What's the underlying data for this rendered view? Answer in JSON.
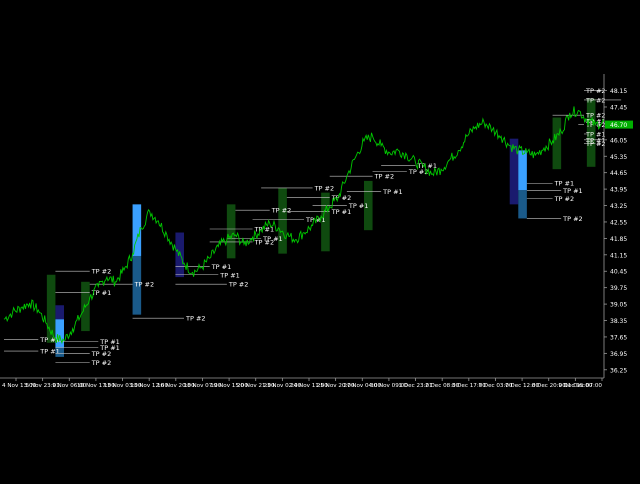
{
  "window": {
    "symbol_label": ""
  },
  "colors": {
    "background": "#000000",
    "price_line": "#00c800",
    "axis": "#9a9a9a",
    "axis_text": "#ffffff",
    "tp_line": "#c8c8c8",
    "tp_text": "#ffffff",
    "bull_zone": "#0f4a0f",
    "bull_zone_bright": "#1f8f1f",
    "bear_zone_dark": "#1a1a6e",
    "bear_zone_bright": "#3aa0ff",
    "bear_zone_mid": "#1a5a8a",
    "current_price_box": "#00b000"
  },
  "chart_data": {
    "type": "line",
    "series": [
      {
        "values": [
          38.4,
          38.7,
          38.9,
          39.1,
          38.8,
          38.2,
          37.6,
          37.5,
          38.0,
          38.6,
          39.3,
          39.8,
          40.2,
          40.0,
          40.5,
          41.2,
          42.3,
          43.0,
          42.6,
          42.0,
          41.4,
          40.8,
          40.4,
          40.6,
          41.0,
          41.5,
          41.8,
          42.0,
          41.6,
          41.9,
          42.2,
          42.5,
          42.3,
          42.0,
          41.8,
          42.1,
          42.4,
          42.8,
          43.2,
          43.6,
          44.5,
          45.3,
          46.0,
          46.2,
          45.8,
          45.5,
          45.6,
          45.4,
          45.1,
          44.9,
          44.6,
          44.8,
          45.2,
          45.6,
          46.2,
          46.6,
          46.8,
          46.5,
          46.2,
          45.8,
          45.6,
          45.5,
          45.4,
          45.7,
          46.0,
          46.4,
          47.2,
          47.3,
          46.9,
          46.7,
          46.8
        ]
      }
    ],
    "x_tick_labels": [
      "4 Nov 13:00",
      "5 Nov 23:01",
      "9 Nov 06:00",
      "10 Nov 17:00",
      "13 Nov 03:00",
      "13 Nov 12:00",
      "16 Nov 20:00",
      "18 Nov 07:00",
      "19 Nov 15:00",
      "20 Nov 21:00",
      "23 Nov 02:00",
      "24 Nov 11:00",
      "25 Nov 20:00",
      "27 Nov 04:00",
      "30 Nov 09:00",
      "1 Dec 23:01",
      "2 Dec 08:00",
      "3 Dec 17:00",
      "7 Dec 03:00",
      "7 Dec 12:00",
      "8 Dec 20:00",
      "9 Dec 05:00",
      "11 Dec 07:00"
    ],
    "y_ticks": [
      36.25,
      36.95,
      37.65,
      38.35,
      39.05,
      39.75,
      40.45,
      41.15,
      41.85,
      42.55,
      43.25,
      43.95,
      44.65,
      45.35,
      46.05,
      46.75,
      47.45,
      48.15
    ],
    "y_tick_labels": [
      "36.25",
      "36.95",
      "37.65",
      "38.35",
      "39.05",
      "39.75",
      "40.45",
      "41.15",
      "41.85",
      "42.55",
      "43.25",
      "43.95",
      "44.65",
      "45.35",
      "46.05",
      "46.75",
      "47.45",
      "48.15"
    ],
    "ylim": [
      35.9,
      48.6
    ],
    "current_price": 46.7,
    "zones": [
      {
        "i0": 5,
        "i1": 6,
        "y0": 37.4,
        "y1": 40.3,
        "kind": "bull_zone"
      },
      {
        "i0": 6,
        "i1": 7,
        "y0": 37.0,
        "y1": 39.0,
        "kind": "bear_zone_dark"
      },
      {
        "i0": 6,
        "i1": 7,
        "y0": 37.2,
        "y1": 38.4,
        "kind": "bear_zone_bright"
      },
      {
        "i0": 6,
        "i1": 7,
        "y0": 36.8,
        "y1": 37.2,
        "kind": "bear_zone_mid"
      },
      {
        "i0": 9,
        "i1": 10,
        "y0": 37.9,
        "y1": 40.0,
        "kind": "bull_zone"
      },
      {
        "i0": 15,
        "i1": 16,
        "y0": 41.1,
        "y1": 43.3,
        "kind": "bear_zone_bright"
      },
      {
        "i0": 15,
        "i1": 16,
        "y0": 38.6,
        "y1": 41.1,
        "kind": "bear_zone_mid"
      },
      {
        "i0": 20,
        "i1": 21,
        "y0": 40.2,
        "y1": 42.1,
        "kind": "bear_zone_dark"
      },
      {
        "i0": 26,
        "i1": 27,
        "y0": 41.0,
        "y1": 43.3,
        "kind": "bull_zone"
      },
      {
        "i0": 32,
        "i1": 33,
        "y0": 41.2,
        "y1": 44.0,
        "kind": "bull_zone"
      },
      {
        "i0": 37,
        "i1": 38,
        "y0": 41.3,
        "y1": 43.8,
        "kind": "bull_zone"
      },
      {
        "i0": 42,
        "i1": 43,
        "y0": 42.2,
        "y1": 44.3,
        "kind": "bull_zone"
      },
      {
        "i0": 59,
        "i1": 60,
        "y0": 43.3,
        "y1": 46.1,
        "kind": "bear_zone_dark"
      },
      {
        "i0": 60,
        "i1": 61,
        "y0": 43.9,
        "y1": 45.6,
        "kind": "bear_zone_bright"
      },
      {
        "i0": 60,
        "i1": 61,
        "y0": 42.7,
        "y1": 43.9,
        "kind": "bear_zone_mid"
      },
      {
        "i0": 64,
        "i1": 65,
        "y0": 44.8,
        "y1": 47.0,
        "kind": "bull_zone"
      },
      {
        "i0": 68,
        "i1": 69,
        "y0": 44.9,
        "y1": 47.8,
        "kind": "bull_zone"
      },
      {
        "i0": 81,
        "i1": 82,
        "y0": 45.1,
        "y1": 46.9,
        "kind": "bull_zone_bright"
      }
    ],
    "tp_labels": [
      {
        "i0": 0,
        "i1": 4,
        "y": 37.55,
        "text": "TP #2"
      },
      {
        "i0": 0,
        "i1": 4,
        "y": 37.05,
        "text": "TP #1"
      },
      {
        "i0": 6,
        "i1": 11,
        "y": 37.45,
        "text": "TP #1"
      },
      {
        "i0": 6,
        "i1": 11,
        "y": 37.2,
        "text": "TP #1"
      },
      {
        "i0": 6,
        "i1": 10,
        "y": 36.95,
        "text": "TP #2"
      },
      {
        "i0": 6,
        "i1": 10,
        "y": 36.55,
        "text": "TP #2"
      },
      {
        "i0": 6,
        "i1": 10,
        "y": 40.45,
        "text": "TP #2"
      },
      {
        "i0": 6,
        "i1": 10,
        "y": 39.55,
        "text": "TP #1"
      },
      {
        "i0": 10,
        "i1": 15,
        "y": 39.9,
        "text": "TP #2"
      },
      {
        "i0": 15,
        "i1": 21,
        "y": 38.45,
        "text": "TP #2"
      },
      {
        "i0": 20,
        "i1": 24,
        "y": 40.65,
        "text": "TP #1"
      },
      {
        "i0": 20,
        "i1": 25,
        "y": 40.3,
        "text": "TP #1"
      },
      {
        "i0": 20,
        "i1": 26,
        "y": 39.9,
        "text": "TP #2"
      },
      {
        "i0": 24,
        "i1": 29,
        "y": 41.7,
        "text": "TP #2"
      },
      {
        "i0": 24,
        "i1": 29,
        "y": 42.25,
        "text": "TP #1"
      },
      {
        "i0": 26,
        "i1": 30,
        "y": 41.85,
        "text": "TP #1"
      },
      {
        "i0": 27,
        "i1": 31,
        "y": 43.05,
        "text": "TP #2"
      },
      {
        "i0": 29,
        "i1": 35,
        "y": 42.65,
        "text": "TP #1"
      },
      {
        "i0": 30,
        "i1": 36,
        "y": 44.0,
        "text": "TP #2"
      },
      {
        "i0": 33,
        "i1": 38,
        "y": 43.6,
        "text": "TP #2"
      },
      {
        "i0": 33,
        "i1": 38,
        "y": 43.0,
        "text": "TP #1"
      },
      {
        "i0": 36,
        "i1": 40,
        "y": 43.25,
        "text": "TP #1"
      },
      {
        "i0": 38,
        "i1": 43,
        "y": 44.5,
        "text": "TP #2"
      },
      {
        "i0": 40,
        "i1": 44,
        "y": 43.85,
        "text": "TP #1"
      },
      {
        "i0": 43,
        "i1": 47,
        "y": 44.7,
        "text": "TP #2"
      },
      {
        "i0": 44,
        "i1": 48,
        "y": 44.95,
        "text": "TP #1"
      },
      {
        "i0": 61,
        "i1": 64,
        "y": 44.2,
        "text": "TP #1"
      },
      {
        "i0": 61,
        "i1": 65,
        "y": 43.9,
        "text": "TP #1"
      },
      {
        "i0": 61,
        "i1": 64,
        "y": 43.55,
        "text": "TP #2"
      },
      {
        "i0": 61,
        "i1": 65,
        "y": 42.7,
        "text": "TP #2"
      },
      {
        "i0": 64,
        "i1": 70,
        "y": 47.1,
        "text": "TP #2"
      },
      {
        "i0": 67,
        "i1": 71,
        "y": 46.7,
        "text": "TP #2"
      },
      {
        "i0": 68,
        "i1": 74,
        "y": 46.85,
        "text": "TP #1"
      },
      {
        "i0": 68,
        "i1": 72,
        "y": 46.3,
        "text": "TP #1"
      },
      {
        "i0": 69,
        "i1": 73,
        "y": 45.9,
        "text": "TP #2"
      },
      {
        "i0": 70,
        "i1": 74,
        "y": 46.05,
        "text": "TP #1"
      },
      {
        "i0": 70,
        "i1": 74,
        "y": 48.15,
        "text": "TP #2"
      },
      {
        "i0": 72,
        "i1": 76,
        "y": 47.75,
        "text": "TP #2"
      }
    ]
  }
}
